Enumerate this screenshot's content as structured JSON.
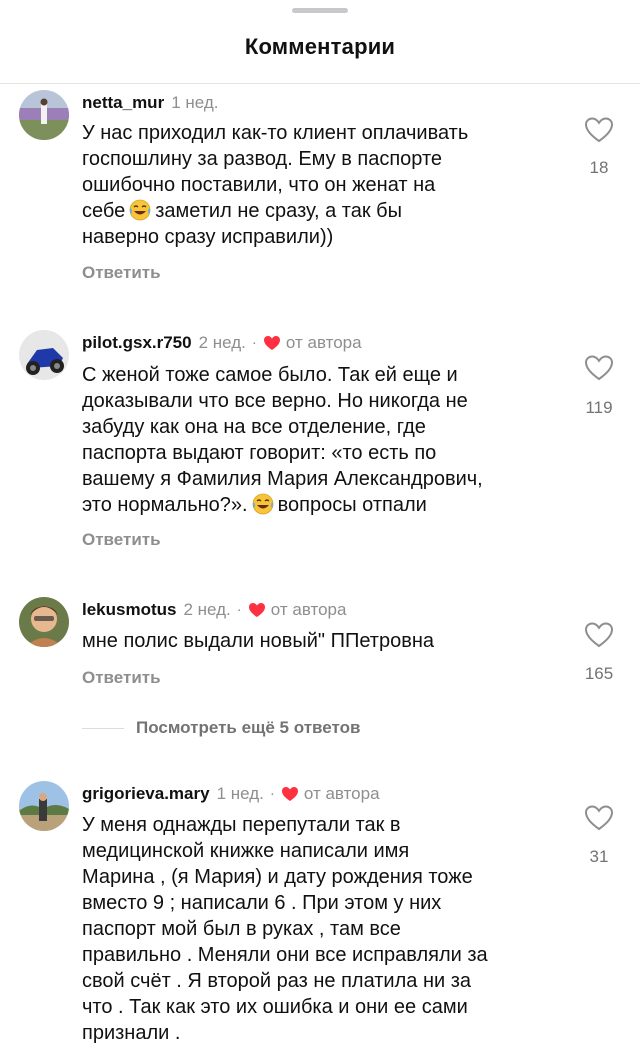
{
  "header": {
    "title": "Комментарии"
  },
  "comments": [
    {
      "username": "netta_mur",
      "time": "1 нед.",
      "author_liked": false,
      "lines": [
        {
          "text": "У нас приходил как-то клиент оплачивать"
        },
        {
          "text": "госпошлину за развод. Ему в паспорте"
        },
        {
          "text": "ошибочно поставили, что он женат на"
        },
        {
          "before": "себе",
          "emoji": "tears-of-joy-emoji",
          "after": "заметил не сразу, а так бы"
        },
        {
          "text": "наверно сразу исправили))"
        }
      ],
      "reply_label": "Ответить",
      "likes": "18"
    },
    {
      "username": "pilot.gsx.r750",
      "time": "2 нед.",
      "separator": "·",
      "author_liked": true,
      "author_label": "от автора",
      "lines": [
        {
          "text": "С женой тоже самое было. Так ей еще и"
        },
        {
          "text": "доказывали что все верно. Но никогда не"
        },
        {
          "text": "забуду как она на все отделение, где"
        },
        {
          "text": "паспорта выдают говорит: «то есть по"
        },
        {
          "text": "вашему я Фамилия Мария Александрович,"
        },
        {
          "before": "это нормально?».",
          "emoji": "tears-of-joy-emoji",
          "after": "вопросы отпали"
        }
      ],
      "reply_label": "Ответить",
      "likes": "119"
    },
    {
      "username": "lekusmotus",
      "time": "2 нед.",
      "separator": "·",
      "author_liked": true,
      "author_label": "от автора",
      "lines": [
        {
          "text": "мне полис выдали новый\" ППетровна"
        }
      ],
      "reply_label": "Ответить",
      "likes": "165"
    },
    {
      "username": "grigorieva.mary",
      "time": "1 нед.",
      "separator": "·",
      "author_liked": true,
      "author_label": "от автора",
      "lines": [
        {
          "text": "У меня однажды перепутали так в"
        },
        {
          "text": "медицинской книжке написали имя"
        },
        {
          "text": "Марина , (я Мария) и дату рождения тоже"
        },
        {
          "text": "вместо 9 ; написали 6 . При этом у них"
        },
        {
          "text": "паспорт мой был в руках , там все"
        },
        {
          "text": "правильно . Меняли они все исправляли за"
        },
        {
          "text": "свой счёт . Я второй раз не платила ни за"
        },
        {
          "text": "что . Так как это их ошибка и они ее сами"
        },
        {
          "text": "признали ."
        }
      ],
      "likes": "31"
    }
  ],
  "view_more": {
    "label": "Посмотреть ещё 5 ответов"
  },
  "icons": {
    "like": "heart-outline-icon",
    "author_heart": "red-heart-icon",
    "emoji": "tears-of-joy-emoji"
  },
  "colors": {
    "author_heart": "#ff3040",
    "secondary_text": "#8e8e8e",
    "primary_text": "#111111"
  }
}
